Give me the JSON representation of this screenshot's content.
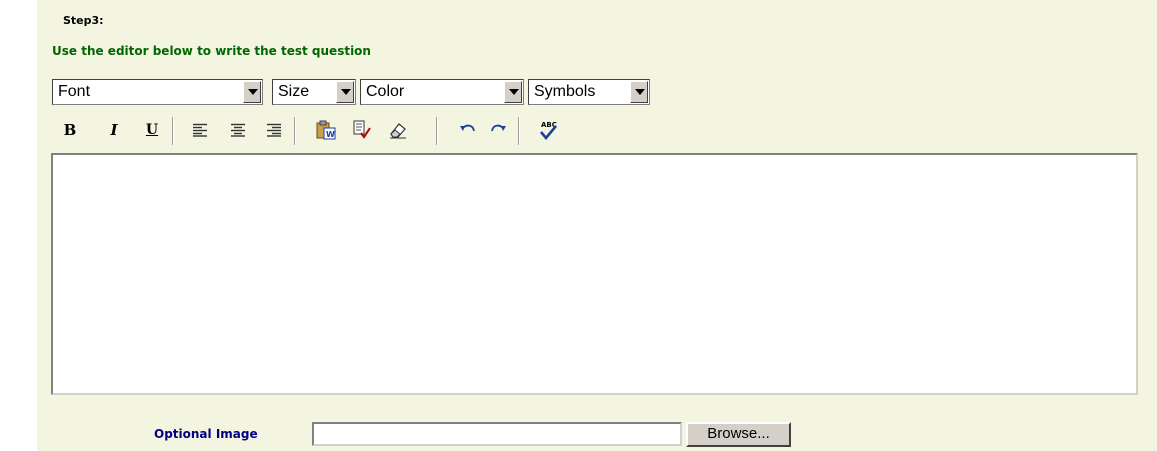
{
  "step": {
    "label": "Step3:"
  },
  "instruction": "Use the editor below to write the test question",
  "dropdowns": {
    "font": "Font",
    "size": "Size",
    "color": "Color",
    "symbols": "Symbols"
  },
  "toolbar": {
    "bold": "B",
    "italic": "I",
    "underline": "U"
  },
  "editor": {
    "content": ""
  },
  "optional_image": {
    "label": "Optional Image",
    "value": "",
    "browse_label": "Browse..."
  },
  "colors": {
    "panel_bg": "#f4f5e1",
    "instruction": "#006600",
    "label": "#000080"
  }
}
